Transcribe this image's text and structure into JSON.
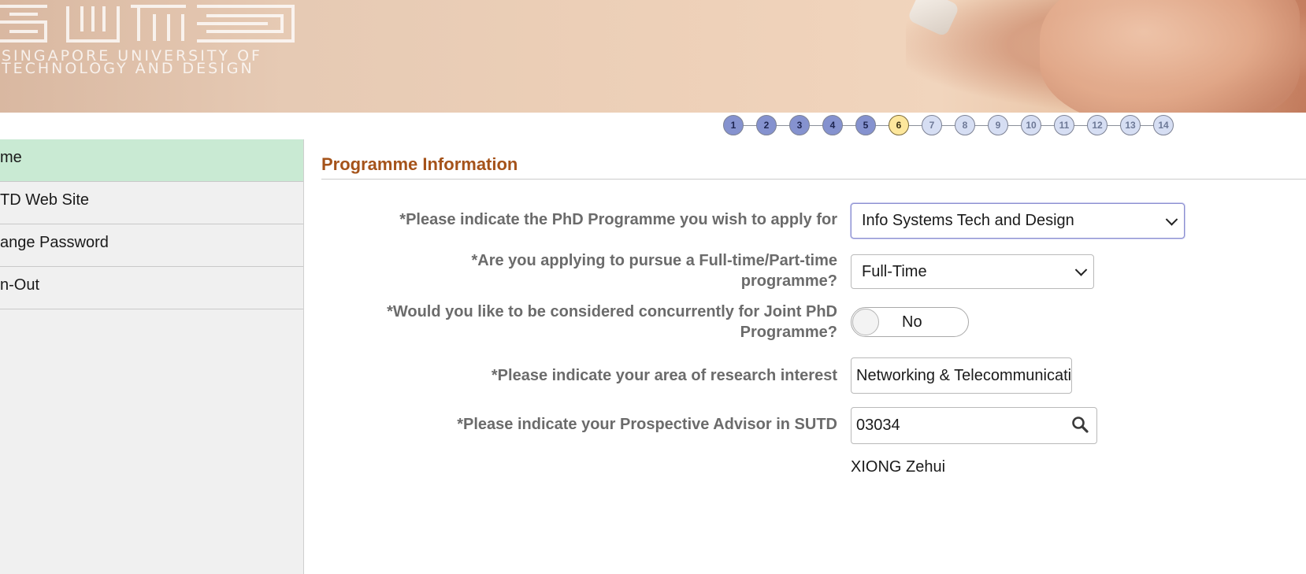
{
  "banner": {
    "logo_line1": "SINGAPORE UNIVERSITY OF",
    "logo_line2": "TECHNOLOGY AND DESIGN"
  },
  "steps": [
    {
      "label": "1",
      "state": "done"
    },
    {
      "label": "2",
      "state": "done"
    },
    {
      "label": "3",
      "state": "done"
    },
    {
      "label": "4",
      "state": "done"
    },
    {
      "label": "5",
      "state": "done"
    },
    {
      "label": "6",
      "state": "current"
    },
    {
      "label": "7",
      "state": "todo"
    },
    {
      "label": "8",
      "state": "todo"
    },
    {
      "label": "9",
      "state": "todo"
    },
    {
      "label": "10",
      "state": "todo"
    },
    {
      "label": "11",
      "state": "todo"
    },
    {
      "label": "12",
      "state": "todo"
    },
    {
      "label": "13",
      "state": "todo"
    },
    {
      "label": "14",
      "state": "todo"
    }
  ],
  "sidebar": {
    "items": [
      {
        "label": "me",
        "active": true
      },
      {
        "label": "TD Web Site",
        "active": false
      },
      {
        "label": "ange Password",
        "active": false
      },
      {
        "label": "n-Out",
        "active": false
      }
    ]
  },
  "main": {
    "section_title": "Programme Information",
    "phd_programme": {
      "label": "*Please indicate the PhD Programme you wish to apply for",
      "value": "Info Systems Tech and Design"
    },
    "study_mode": {
      "label_line1": "*Are you applying to pursue a Full-time/Part-time",
      "label_line2": "programme?",
      "value": "Full-Time"
    },
    "joint_phd": {
      "label_line1": "*Would you like to be considered concurrently for Joint PhD",
      "label_line2": "Programme?",
      "value": "No"
    },
    "research_interest": {
      "label": "*Please indicate your area of research interest",
      "value": "Networking & Telecommunications"
    },
    "advisor": {
      "label": "*Please indicate your Prospective Advisor in SUTD",
      "value": "03034",
      "name": "XIONG Zehui"
    }
  },
  "colors": {
    "section_title": "#a5531a",
    "step_done": "#8592cf",
    "step_current": "#fde79c",
    "step_todo": "#d6def3",
    "sidebar_active": "#c9ead3"
  }
}
